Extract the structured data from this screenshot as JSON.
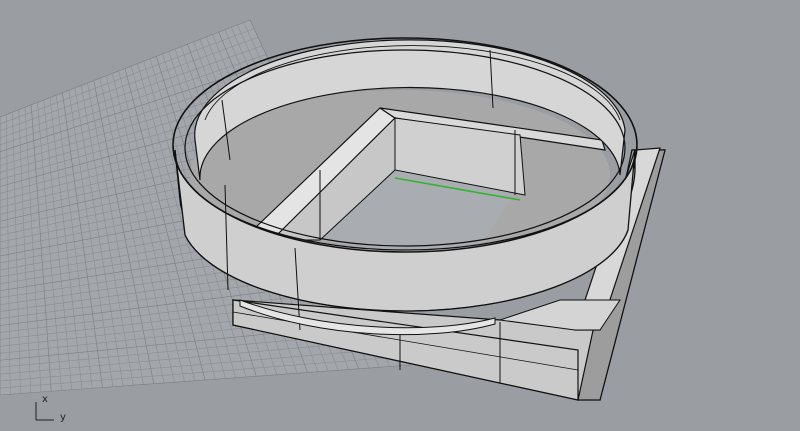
{
  "viewport": {
    "background": "#9a9da2",
    "grid_color": "#8a8d92",
    "grid_major_color": "#7a7d82",
    "x_axis_color": "#2fb52f",
    "surface_light": "#e6e6e6",
    "surface_mid": "#c8c8c8",
    "surface_dark": "#9e9e9e",
    "edge_color": "#101010"
  },
  "axis_widget": {
    "x_label": "x",
    "y_label": "y",
    "icon": "world-axes-icon"
  }
}
